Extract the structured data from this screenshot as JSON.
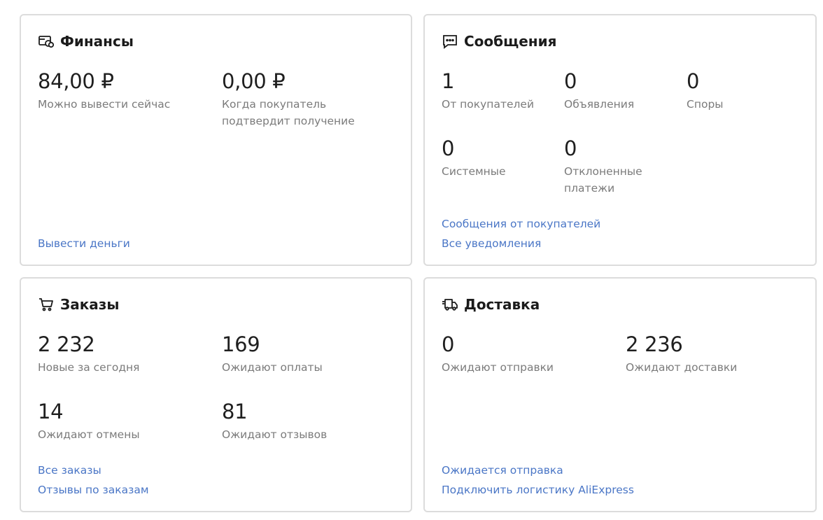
{
  "colors": {
    "link": "#4a76c6",
    "label": "#7b7b7b",
    "value": "#1f1f1f",
    "border": "#dcdcdc"
  },
  "finance": {
    "icon": "wallet-coins-icon",
    "title": "Финансы",
    "stats": [
      {
        "value": "84,00 ₽",
        "label": "Можно вывести сейчас"
      },
      {
        "value": "0,00 ₽",
        "label": "Когда покупатель подтвердит получение"
      }
    ],
    "links": [
      "Вывести деньги"
    ]
  },
  "messages": {
    "icon": "chat-bubble-icon",
    "title": "Сообщения",
    "stats": [
      {
        "value": "1",
        "label": "От покупателей"
      },
      {
        "value": "0",
        "label": "Объявления"
      },
      {
        "value": "0",
        "label": "Споры"
      },
      {
        "value": "0",
        "label": "Системные"
      },
      {
        "value": "0",
        "label": "Отклоненные платежи"
      }
    ],
    "links": [
      "Сообщения от покупателей",
      "Все уведомления"
    ]
  },
  "orders": {
    "icon": "shopping-cart-icon",
    "title": "Заказы",
    "stats": [
      {
        "value": "2 232",
        "label": "Новые за сегодня"
      },
      {
        "value": "169",
        "label": "Ожидают оплаты"
      },
      {
        "value": "14",
        "label": "Ожидают отмены"
      },
      {
        "value": "81",
        "label": "Ожидают отзывов"
      }
    ],
    "links": [
      "Все заказы",
      "Отзывы по заказам"
    ]
  },
  "delivery": {
    "icon": "delivery-truck-icon",
    "title": "Доставка",
    "stats": [
      {
        "value": "0",
        "label": "Ожидают отправки"
      },
      {
        "value": "2 236",
        "label": "Ожидают доставки"
      }
    ],
    "links": [
      "Ожидается отправка",
      "Подключить логистику AliExpress"
    ]
  }
}
